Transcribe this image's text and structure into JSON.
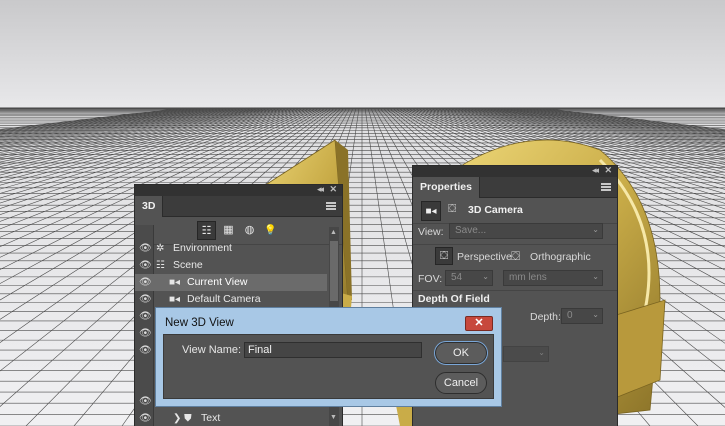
{
  "panel_3d": {
    "tab": "3D",
    "tools": [
      {
        "name": "whole-scene",
        "glyph": "☷"
      },
      {
        "name": "meshes",
        "glyph": "▦"
      },
      {
        "name": "materials",
        "glyph": "◍"
      },
      {
        "name": "lights",
        "glyph": "💡"
      }
    ],
    "rows": [
      {
        "label": "Environment",
        "icon": "✲"
      },
      {
        "label": "Scene",
        "icon": "☷"
      },
      {
        "label": "Current View",
        "icon": "■◂"
      },
      {
        "label": "Default Camera",
        "icon": "■◂"
      },
      {
        "label": "Text",
        "icon": "❯ ⛊"
      }
    ]
  },
  "properties_panel": {
    "tab": "Properties",
    "section_title": "3D Camera",
    "view_label": "View:",
    "view_placeholder": "Save...",
    "perspective_label": "Perspective",
    "orthographic_label": "Orthographic",
    "fov_label": "FOV:",
    "fov_value": "54",
    "fov_unit": "mm lens",
    "depth_of_field_label": "Depth Of Field",
    "depth_label": "Depth:",
    "depth_value": "0"
  },
  "dialog": {
    "title": "New 3D View",
    "close_glyph": "✕",
    "view_name_label": "View Name:",
    "view_name_value": "Final",
    "ok_label": "OK",
    "cancel_label": "Cancel"
  },
  "panel_controls": {
    "collapse_glyph": "◂◂",
    "close_glyph": "✕"
  },
  "colors": {
    "panel_bg": "#535353",
    "panel_dark": "#323232",
    "dialog_chrome": "#a8c8e6",
    "close_red": "#c7483c",
    "object_gold": "#c9ac48"
  }
}
